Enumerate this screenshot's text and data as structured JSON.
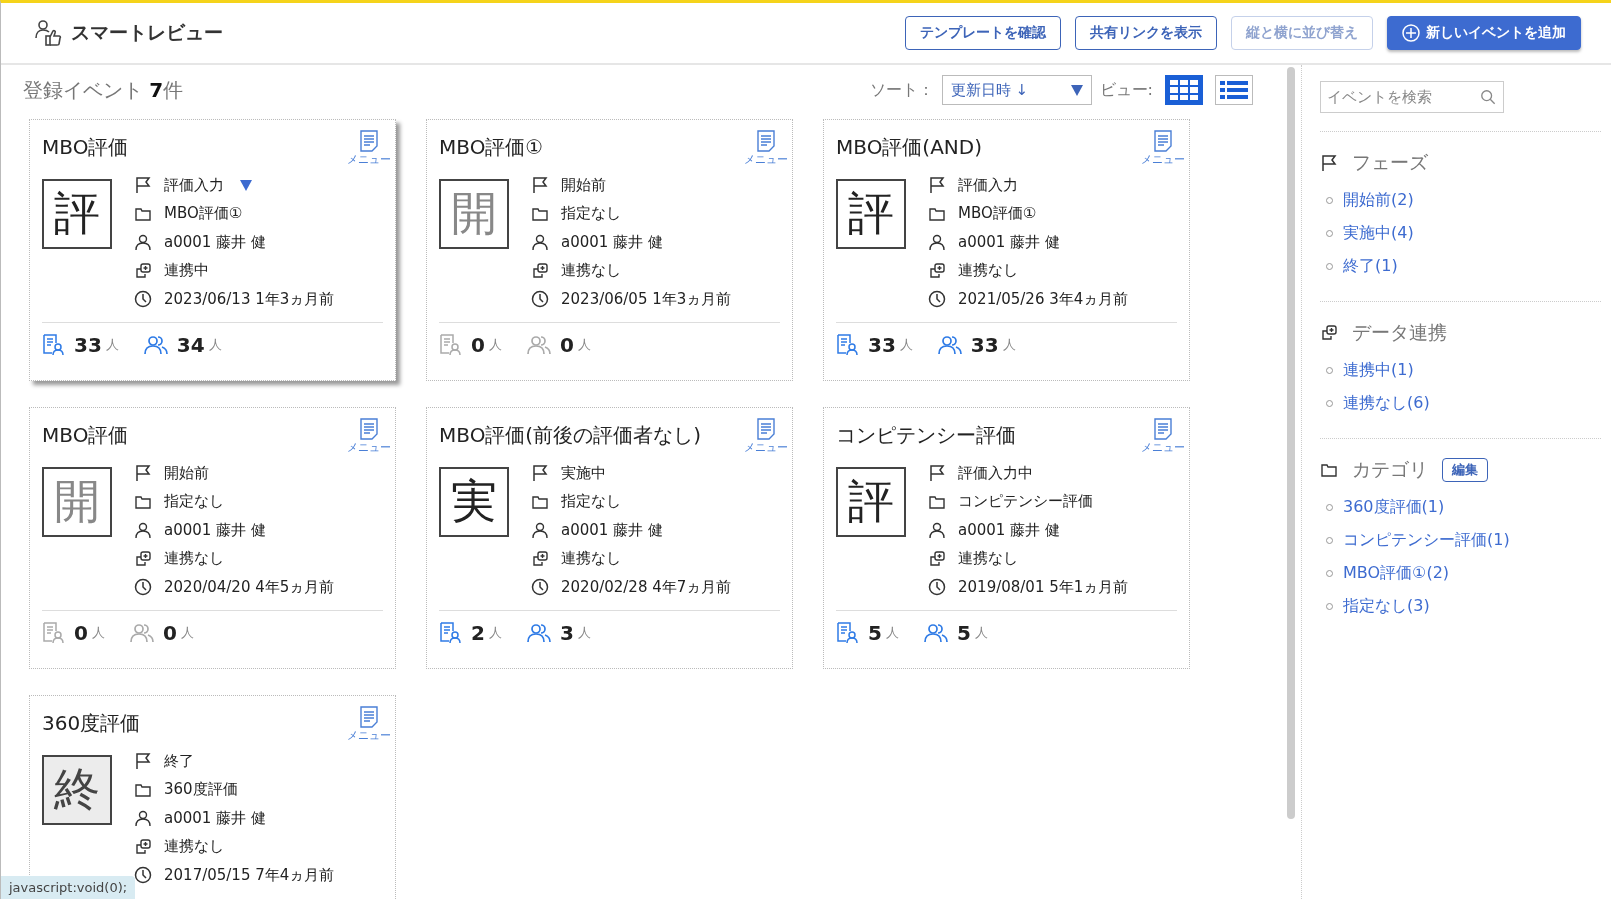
{
  "header": {
    "title": "スマートレビュー",
    "buttons": [
      {
        "label": "テンプレートを確認",
        "kind": "outline",
        "disabled": false
      },
      {
        "label": "共有リンクを表示",
        "kind": "outline",
        "disabled": false
      },
      {
        "label": "縦と横に並び替え",
        "kind": "outline",
        "disabled": true
      },
      {
        "label": "新しいイベントを追加",
        "kind": "primary",
        "disabled": false
      }
    ]
  },
  "summary": {
    "label": "登録イベント",
    "count": "7",
    "unit": "件"
  },
  "toolbar": {
    "sort_label": "ソート：",
    "sort_value": "更新日時 ↓",
    "view_label": "ビュー:",
    "views": [
      {
        "kind": "grid",
        "selected": true
      },
      {
        "kind": "list",
        "selected": false
      }
    ]
  },
  "cards": [
    {
      "title": "MBO評価",
      "menu": "メニュー",
      "glyph": "評",
      "kind": "active",
      "hovered": true,
      "phase_dropdown": true,
      "rows": [
        {
          "kind": "phase",
          "text": "評価入力"
        },
        {
          "kind": "category",
          "text": "MBO評価①"
        },
        {
          "kind": "owner",
          "text": "a0001 藤井 健"
        },
        {
          "kind": "link",
          "text": "連携中"
        },
        {
          "kind": "date",
          "text": "2023/06/13 1年3ヵ月前"
        }
      ],
      "counts": [
        {
          "kind": "evaluators",
          "value": "33",
          "unit": "人",
          "active": true
        },
        {
          "kind": "targets",
          "value": "34",
          "unit": "人",
          "active": true
        }
      ]
    },
    {
      "title": "MBO評価①",
      "menu": "メニュー",
      "glyph": "開",
      "kind": "pending",
      "hovered": false,
      "phase_dropdown": false,
      "rows": [
        {
          "kind": "phase",
          "text": "開始前"
        },
        {
          "kind": "category",
          "text": "指定なし"
        },
        {
          "kind": "owner",
          "text": "a0001 藤井 健"
        },
        {
          "kind": "link",
          "text": "連携なし"
        },
        {
          "kind": "date",
          "text": "2023/06/05 1年3ヵ月前"
        }
      ],
      "counts": [
        {
          "kind": "evaluators",
          "value": "0",
          "unit": "人",
          "active": false
        },
        {
          "kind": "targets",
          "value": "0",
          "unit": "人",
          "active": false
        }
      ]
    },
    {
      "title": "MBO評価(AND)",
      "menu": "メニュー",
      "glyph": "評",
      "kind": "active",
      "hovered": false,
      "phase_dropdown": false,
      "rows": [
        {
          "kind": "phase",
          "text": "評価入力"
        },
        {
          "kind": "category",
          "text": "MBO評価①"
        },
        {
          "kind": "owner",
          "text": "a0001 藤井 健"
        },
        {
          "kind": "link",
          "text": "連携なし"
        },
        {
          "kind": "date",
          "text": "2021/05/26 3年4ヵ月前"
        }
      ],
      "counts": [
        {
          "kind": "evaluators",
          "value": "33",
          "unit": "人",
          "active": true
        },
        {
          "kind": "targets",
          "value": "33",
          "unit": "人",
          "active": true
        }
      ]
    },
    {
      "title": "MBO評価",
      "menu": "メニュー",
      "glyph": "開",
      "kind": "pending",
      "hovered": false,
      "phase_dropdown": false,
      "rows": [
        {
          "kind": "phase",
          "text": "開始前"
        },
        {
          "kind": "category",
          "text": "指定なし"
        },
        {
          "kind": "owner",
          "text": "a0001 藤井 健"
        },
        {
          "kind": "link",
          "text": "連携なし"
        },
        {
          "kind": "date",
          "text": "2020/04/20 4年5ヵ月前"
        }
      ],
      "counts": [
        {
          "kind": "evaluators",
          "value": "0",
          "unit": "人",
          "active": false
        },
        {
          "kind": "targets",
          "value": "0",
          "unit": "人",
          "active": false
        }
      ]
    },
    {
      "title": "MBO評価(前後の評価者なし)",
      "menu": "メニュー",
      "glyph": "実",
      "kind": "active",
      "hovered": false,
      "phase_dropdown": false,
      "rows": [
        {
          "kind": "phase",
          "text": "実施中"
        },
        {
          "kind": "category",
          "text": "指定なし"
        },
        {
          "kind": "owner",
          "text": "a0001 藤井 健"
        },
        {
          "kind": "link",
          "text": "連携なし"
        },
        {
          "kind": "date",
          "text": "2020/02/28 4年7ヵ月前"
        }
      ],
      "counts": [
        {
          "kind": "evaluators",
          "value": "2",
          "unit": "人",
          "active": true
        },
        {
          "kind": "targets",
          "value": "3",
          "unit": "人",
          "active": true
        }
      ]
    },
    {
      "title": "コンピテンシー評価",
      "menu": "メニュー",
      "glyph": "評",
      "kind": "active",
      "hovered": false,
      "phase_dropdown": false,
      "rows": [
        {
          "kind": "phase",
          "text": "評価入力中"
        },
        {
          "kind": "category",
          "text": "コンピテンシー評価"
        },
        {
          "kind": "owner",
          "text": "a0001 藤井 健"
        },
        {
          "kind": "link",
          "text": "連携なし"
        },
        {
          "kind": "date",
          "text": "2019/08/01 5年1ヵ月前"
        }
      ],
      "counts": [
        {
          "kind": "evaluators",
          "value": "5",
          "unit": "人",
          "active": true
        },
        {
          "kind": "targets",
          "value": "5",
          "unit": "人",
          "active": true
        }
      ]
    },
    {
      "title": "360度評価",
      "menu": "メニュー",
      "glyph": "終",
      "kind": "closed",
      "hovered": false,
      "phase_dropdown": false,
      "rows": [
        {
          "kind": "phase",
          "text": "終了"
        },
        {
          "kind": "category",
          "text": "360度評価"
        },
        {
          "kind": "owner",
          "text": "a0001 藤井 健"
        },
        {
          "kind": "link",
          "text": "連携なし"
        },
        {
          "kind": "date",
          "text": "2017/05/15 7年4ヵ月前"
        }
      ]
    }
  ],
  "sidebar": {
    "search": {
      "placeholder": "イベントを検索"
    },
    "sections": [
      {
        "kind": "phase",
        "title": "フェーズ",
        "items": [
          "開始前(2)",
          "実施中(4)",
          "終了(1)"
        ]
      },
      {
        "kind": "link",
        "title": "データ連携",
        "items": [
          "連携中(1)",
          "連携なし(6)"
        ]
      },
      {
        "kind": "category",
        "title": "カテゴリ",
        "edit": "編集",
        "items": [
          "360度評価(1)",
          "コンピテンシー評価(1)",
          "MBO評価①(2)",
          "指定なし(3)"
        ]
      }
    ]
  },
  "status_bar": {
    "text": "javascript:void(0);"
  }
}
